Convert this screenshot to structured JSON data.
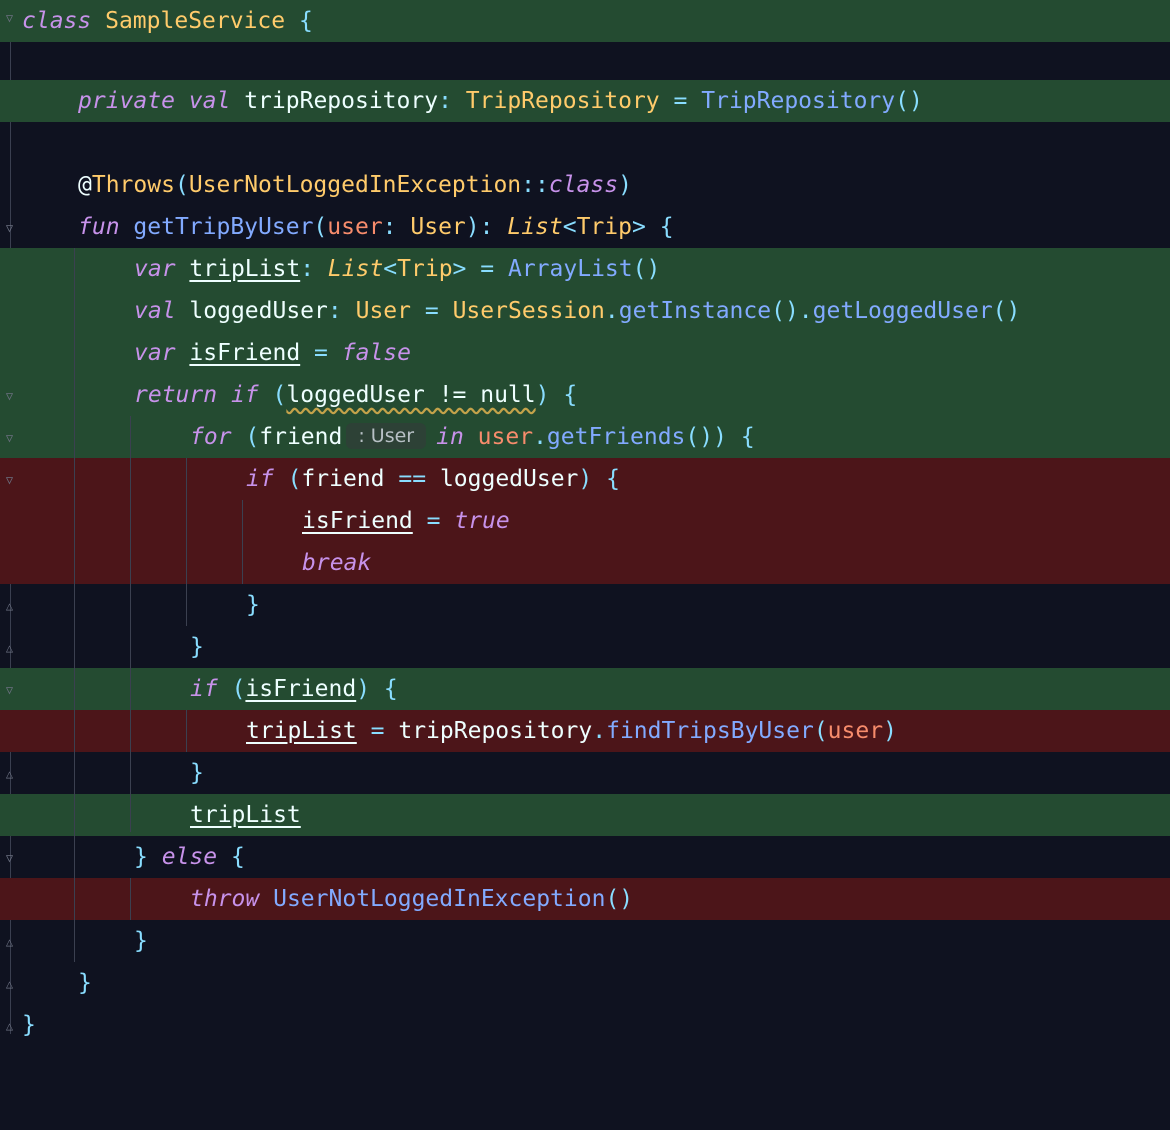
{
  "colors": {
    "background": "#0f1220",
    "added_line": "#244b31",
    "removed_line": "#4c1519",
    "keyword": "#c792ea",
    "type": "#ffcb6b",
    "function": "#82aaff",
    "punctuation": "#89ddff",
    "parameter": "#f78c6c",
    "identifier": "#eeffff"
  },
  "icons": {
    "fold": "fold-marker-icon"
  },
  "code": {
    "l1": {
      "kw_class": "class",
      "name": "SampleService",
      "brace": "{"
    },
    "l3": {
      "kw_private": "private",
      "kw_val": "val",
      "name": "tripRepository",
      "colon": ":",
      "type": "TripRepository",
      "eq": "=",
      "ctor": "TripRepository",
      "parens": "()"
    },
    "l5": {
      "at": "@",
      "ann": "Throws",
      "lp": "(",
      "type": "UserNotLoggedInException",
      "sep": "::",
      "kw_class": "class",
      "rp": ")"
    },
    "l6": {
      "kw_fun": "fun",
      "name": "getTripByUser",
      "lp": "(",
      "param": "user",
      "colon": ":",
      "ptype": "User",
      "rp": ")",
      "colon2": ":",
      "ret": "List",
      "lt": "<",
      "ret_arg": "Trip",
      "gt": ">",
      "brace": "{"
    },
    "l7": {
      "kw_var": "var",
      "name": "tripList",
      "colon": ":",
      "type": "List",
      "lt": "<",
      "type_arg": "Trip",
      "gt": ">",
      "eq": "=",
      "ctor": "ArrayList",
      "parens": "()"
    },
    "l8": {
      "kw_val": "val",
      "name": "loggedUser",
      "colon": ":",
      "type": "User",
      "eq": "=",
      "obj": "UserSession",
      "dot": ".",
      "call1": "getInstance",
      "parens1": "()",
      "dot2": ".",
      "call2": "getLoggedUser",
      "parens2": "()"
    },
    "l9": {
      "kw_var": "var",
      "name": "isFriend",
      "eq": "=",
      "val": "false"
    },
    "l10": {
      "kw_return": "return",
      "kw_if": "if",
      "lp": "(",
      "cond": "loggedUser != null",
      "rp": ")",
      "brace": "{"
    },
    "l11": {
      "kw_for": "for",
      "lp": "(",
      "var": "friend",
      "hint": ": User",
      "kw_in": "in",
      "obj": "user",
      "dot": ".",
      "call": "getFriends",
      "parens": "())",
      "brace": "{"
    },
    "l12": {
      "kw_if": "if",
      "lp": "(",
      "left": "friend",
      "op": "==",
      "right": "loggedUser",
      "rp": ")",
      "brace": "{"
    },
    "l13": {
      "name": "isFriend",
      "eq": "=",
      "val": "true"
    },
    "l14": {
      "kw_break": "break"
    },
    "l15": {
      "brace": "}"
    },
    "l16": {
      "brace": "}"
    },
    "l17": {
      "kw_if": "if",
      "lp": "(",
      "name": "isFriend",
      "rp": ")",
      "brace": "{"
    },
    "l18": {
      "name": "tripList",
      "eq": "=",
      "obj": "tripRepository",
      "dot": ".",
      "call": "findTripsByUser",
      "lp": "(",
      "arg": "user",
      "rp": ")"
    },
    "l19": {
      "brace": "}"
    },
    "l20": {
      "name": "tripList"
    },
    "l21": {
      "brace": "}",
      "kw_else": "else",
      "brace2": "{"
    },
    "l22": {
      "kw_throw": "throw",
      "ctor": "UserNotLoggedInException",
      "parens": "()"
    },
    "l23": {
      "brace": "}"
    },
    "l24": {
      "brace": "}"
    },
    "l25": {
      "brace": "}"
    }
  }
}
